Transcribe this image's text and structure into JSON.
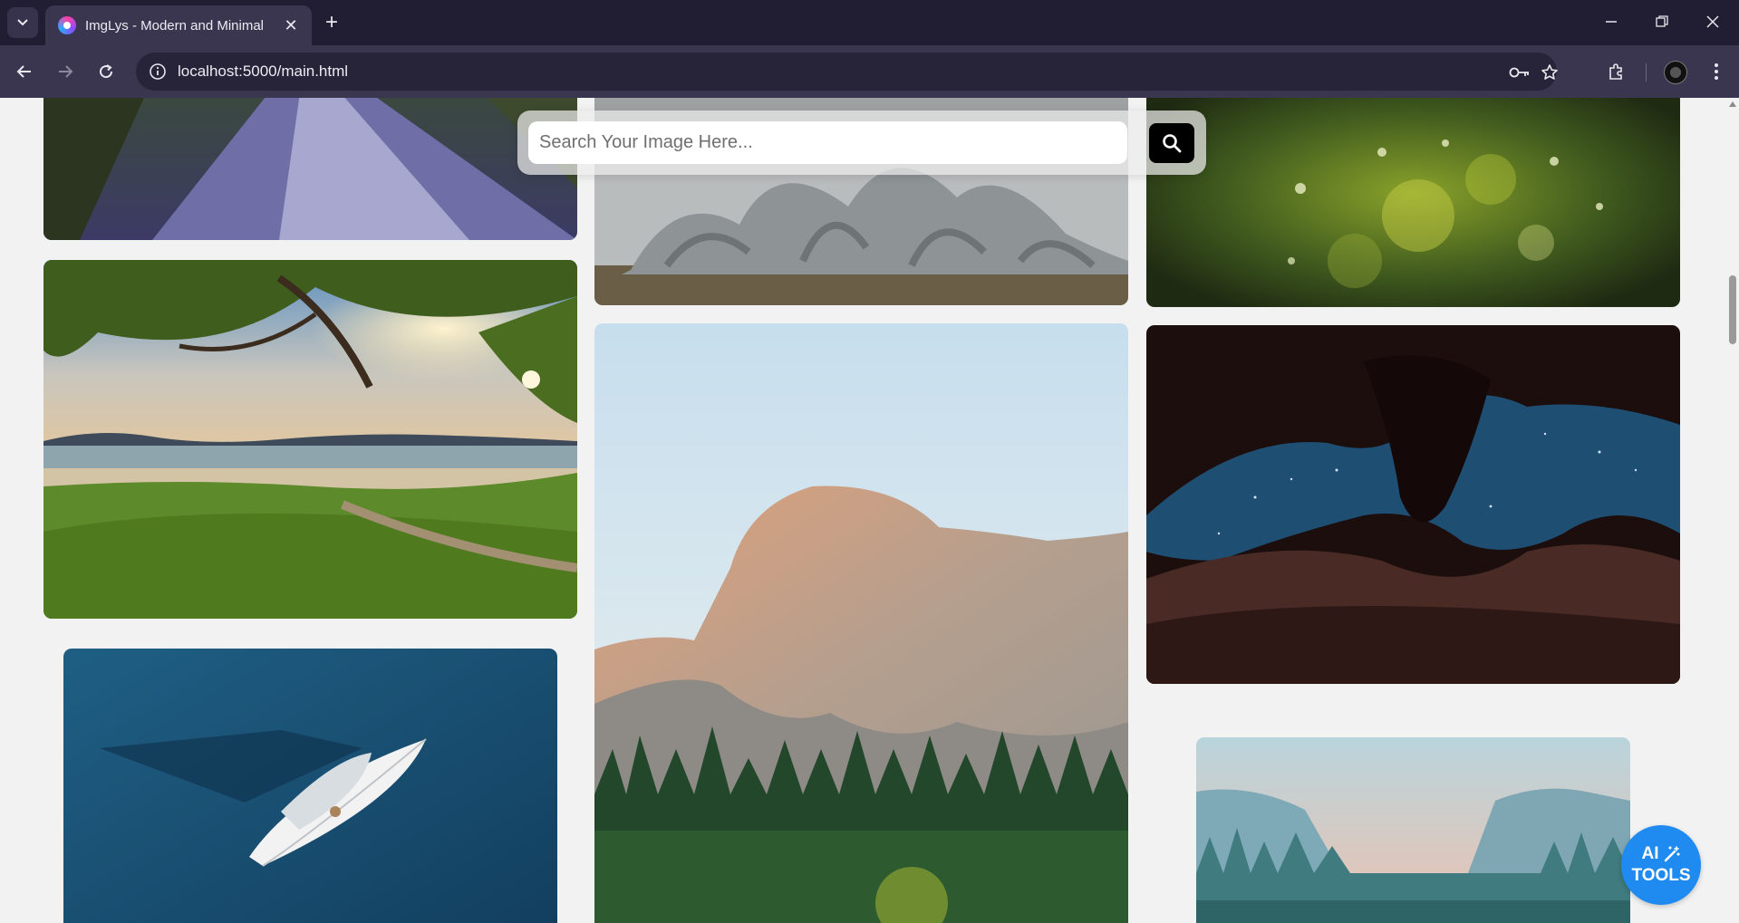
{
  "browser": {
    "tab_title": "ImgLys - Modern and Minimal",
    "url": "localhost:5000/main.html"
  },
  "page": {
    "search": {
      "placeholder": "Search Your Image Here..."
    },
    "ai_tools": {
      "line1": "AI",
      "line2": "TOOLS"
    },
    "images": [
      "dirt-road-forest",
      "tree-roots",
      "green-bokeh",
      "beach-tree-sunset",
      "half-dome-mountain",
      "antelope-canyon-stars",
      "sailboat-ocean",
      "misty-valley-forest"
    ]
  },
  "colors": {
    "accent": "#1f8af0",
    "search_button": "#000000",
    "chrome": "#211e34"
  }
}
